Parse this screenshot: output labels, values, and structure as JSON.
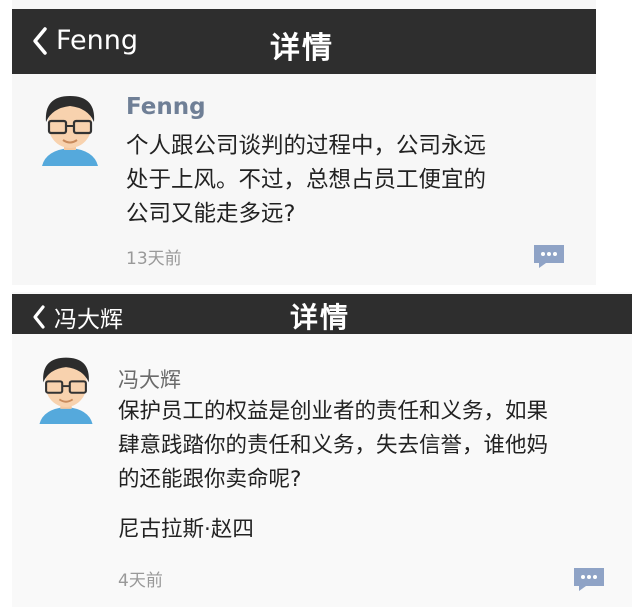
{
  "colors": {
    "navbar": "#2e2e2e",
    "author": "#6f7f96",
    "time": "#999999",
    "comment_icon": "#8fa3c6"
  },
  "post1": {
    "back_label": "Fenng",
    "title": "详情",
    "author": "Fenng",
    "lines": [
      "个人跟公司谈判的过程中，公司永远",
      "处于上风。不过，总想占员工便宜的",
      "公司又能走多远?"
    ],
    "time": "13天前"
  },
  "post2": {
    "back_label": "冯大辉",
    "title": "详情",
    "author": "冯大辉",
    "lines": [
      "保护员工的权益是创业者的责任和义务，如果",
      "肆意践踏你的责任和义务，失去信誉，谁他妈",
      "的还能跟你卖命呢?"
    ],
    "signature": "尼古拉斯·赵四",
    "time": "4天前"
  }
}
